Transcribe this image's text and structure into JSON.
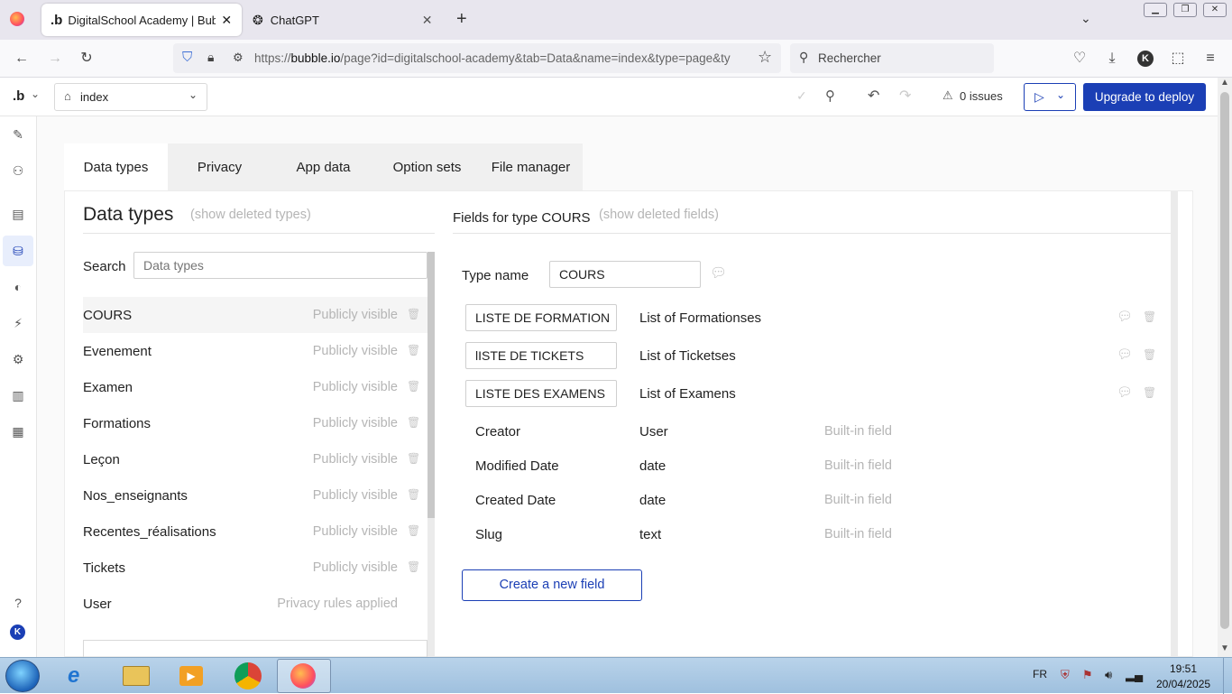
{
  "browser": {
    "tabs": [
      {
        "title": "DigitalSchool Academy | Bubble",
        "active": true
      },
      {
        "title": "ChatGPT",
        "active": false
      }
    ],
    "url_prefix": "https://",
    "url_domain": "bubble.io",
    "url_rest": "/page?id=digitalschool-academy&tab=Data&name=index&type=page&ty",
    "search_placeholder": "Rechercher",
    "profile_initial": "K"
  },
  "editor": {
    "page_name": "index",
    "issues": "0 issues",
    "deploy_label": "Upgrade to deploy"
  },
  "data_tabs": [
    "Data types",
    "Privacy",
    "App data",
    "Option sets",
    "File manager"
  ],
  "left": {
    "title": "Data types",
    "show_deleted": "(show deleted types)",
    "search_label": "Search",
    "search_placeholder": "Data types",
    "types": [
      {
        "name": "COURS",
        "visibility": "Publicly visible"
      },
      {
        "name": "Evenement",
        "visibility": "Publicly visible"
      },
      {
        "name": "Examen",
        "visibility": "Publicly visible"
      },
      {
        "name": "Formations",
        "visibility": "Publicly visible"
      },
      {
        "name": "Leçon",
        "visibility": "Publicly visible"
      },
      {
        "name": "Nos_enseignants",
        "visibility": "Publicly visible"
      },
      {
        "name": "Recentes_réalisations",
        "visibility": "Publicly visible"
      },
      {
        "name": "Tickets",
        "visibility": "Publicly visible"
      },
      {
        "name": "User",
        "visibility": "Privacy rules applied"
      }
    ]
  },
  "right": {
    "title": "Fields for type COURS",
    "show_deleted": "(show deleted fields)",
    "type_name_label": "Type name",
    "type_name_value": "COURS",
    "custom_fields": [
      {
        "name": "LISTE DE FORMATION",
        "type": "List of Formationses"
      },
      {
        "name": "lISTE DE TICKETS",
        "type": "List of Ticketses"
      },
      {
        "name": "LISTE DES EXAMENS",
        "type": "List of Examens"
      }
    ],
    "builtin_fields": [
      {
        "name": "Creator",
        "type": "User",
        "note": "Built-in field"
      },
      {
        "name": "Modified Date",
        "type": "date",
        "note": "Built-in field"
      },
      {
        "name": "Created Date",
        "type": "date",
        "note": "Built-in field"
      },
      {
        "name": "Slug",
        "type": "text",
        "note": "Built-in field"
      }
    ],
    "create_button": "Create a new field"
  },
  "taskbar": {
    "lang": "FR",
    "time": "19:51",
    "date": "20/04/2025"
  }
}
